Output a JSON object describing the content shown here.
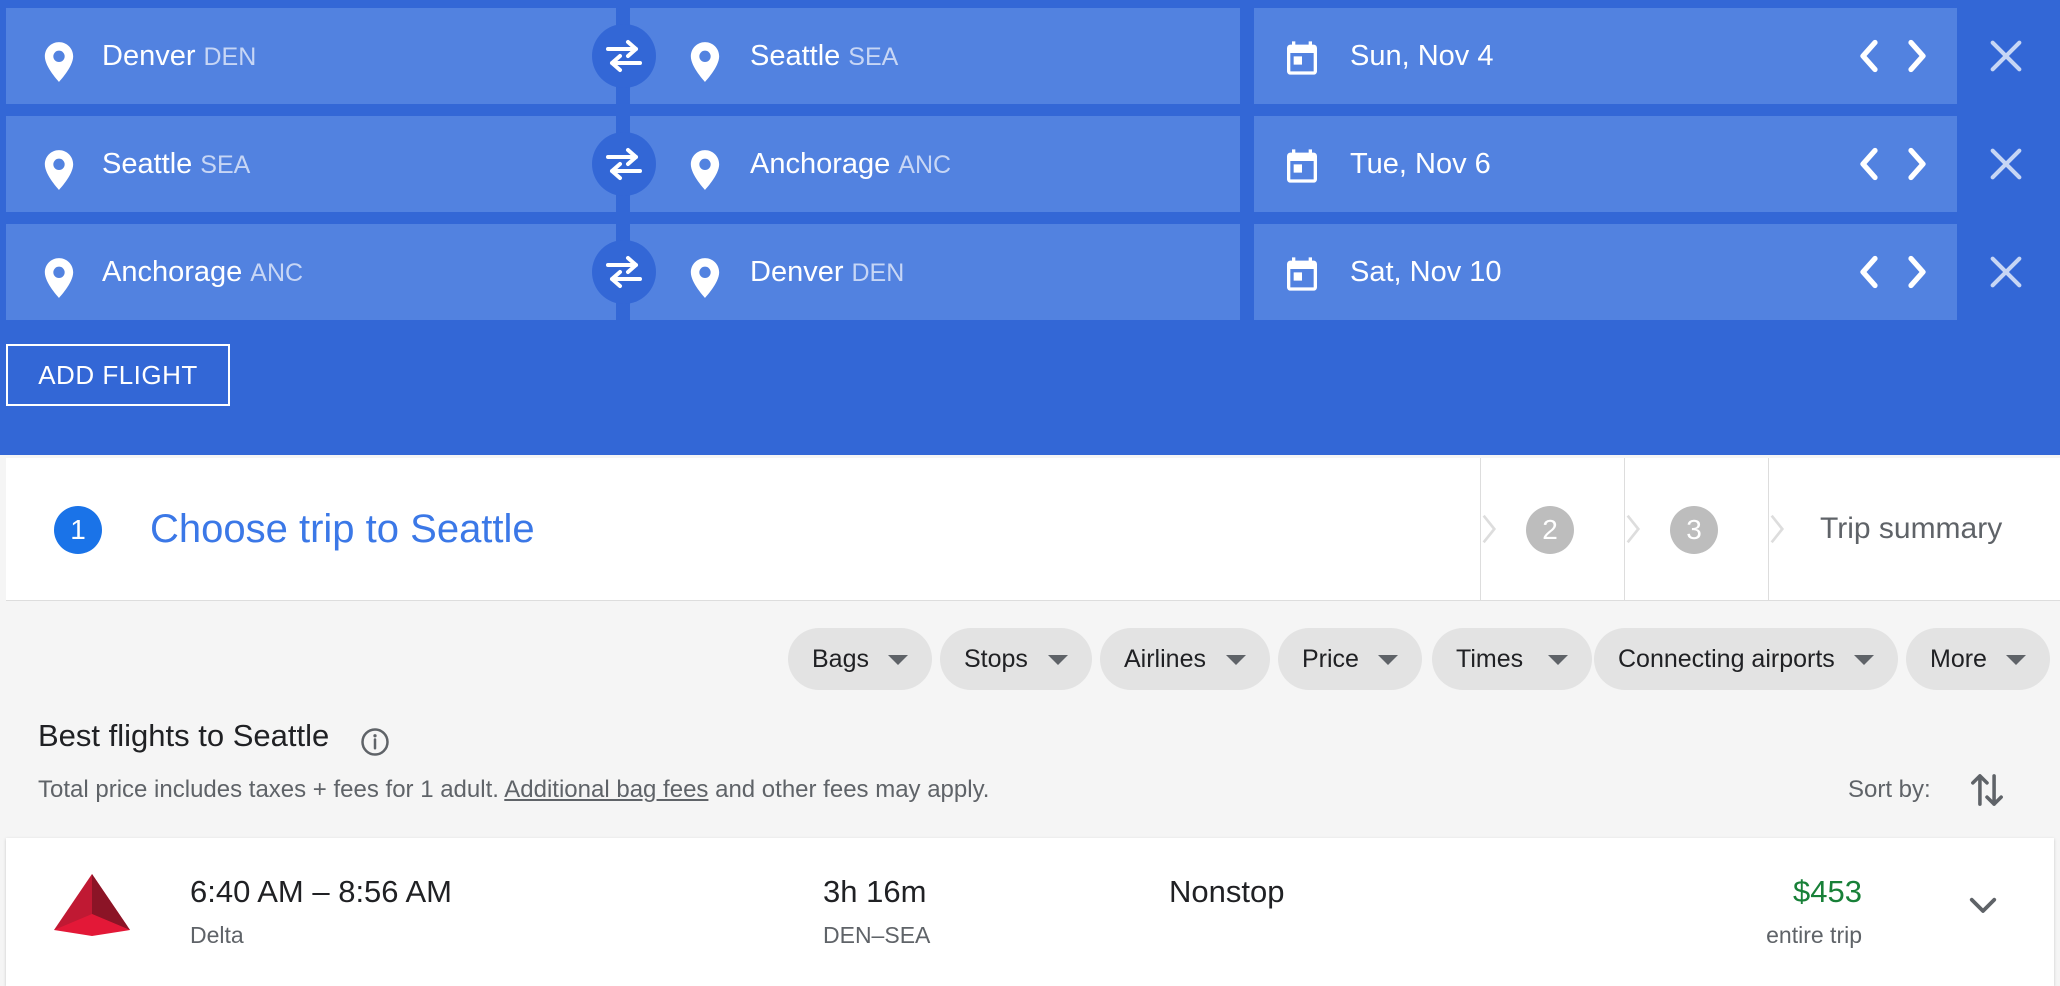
{
  "legs": [
    {
      "from_city": "Denver",
      "from_code": "DEN",
      "to_city": "Seattle",
      "to_code": "SEA",
      "date": "Sun, Nov 4"
    },
    {
      "from_city": "Seattle",
      "from_code": "SEA",
      "to_city": "Anchorage",
      "to_code": "ANC",
      "date": "Tue, Nov 6"
    },
    {
      "from_city": "Anchorage",
      "from_code": "ANC",
      "to_city": "Denver",
      "to_code": "DEN",
      "date": "Sat, Nov 10"
    }
  ],
  "add_flight_label": "ADD FLIGHT",
  "stepper": {
    "active_number": "1",
    "active_title": "Choose trip to Seattle",
    "step2": "2",
    "step3": "3",
    "summary": "Trip summary"
  },
  "filters": [
    "Bags",
    "Stops",
    "Airlines",
    "Price",
    "Times",
    "Connecting airports",
    "More"
  ],
  "results": {
    "title": "Best flights to Seattle",
    "disclaimer_pre": "Total price includes taxes + fees for 1 adult. ",
    "disclaimer_link": "Additional bag fees",
    "disclaimer_post": " and other fees may apply.",
    "sort_label": "Sort by:"
  },
  "flights": [
    {
      "times": "6:40 AM – 8:56 AM",
      "airline": "Delta",
      "duration": "3h 16m",
      "route": "DEN–SEA",
      "stops": "Nonstop",
      "price": "$453",
      "price_note": "entire trip"
    }
  ],
  "colors": {
    "header_bg": "#3367d6",
    "field_bg": "#5282e0",
    "accent": "#1a73e8",
    "price": "#188038"
  }
}
